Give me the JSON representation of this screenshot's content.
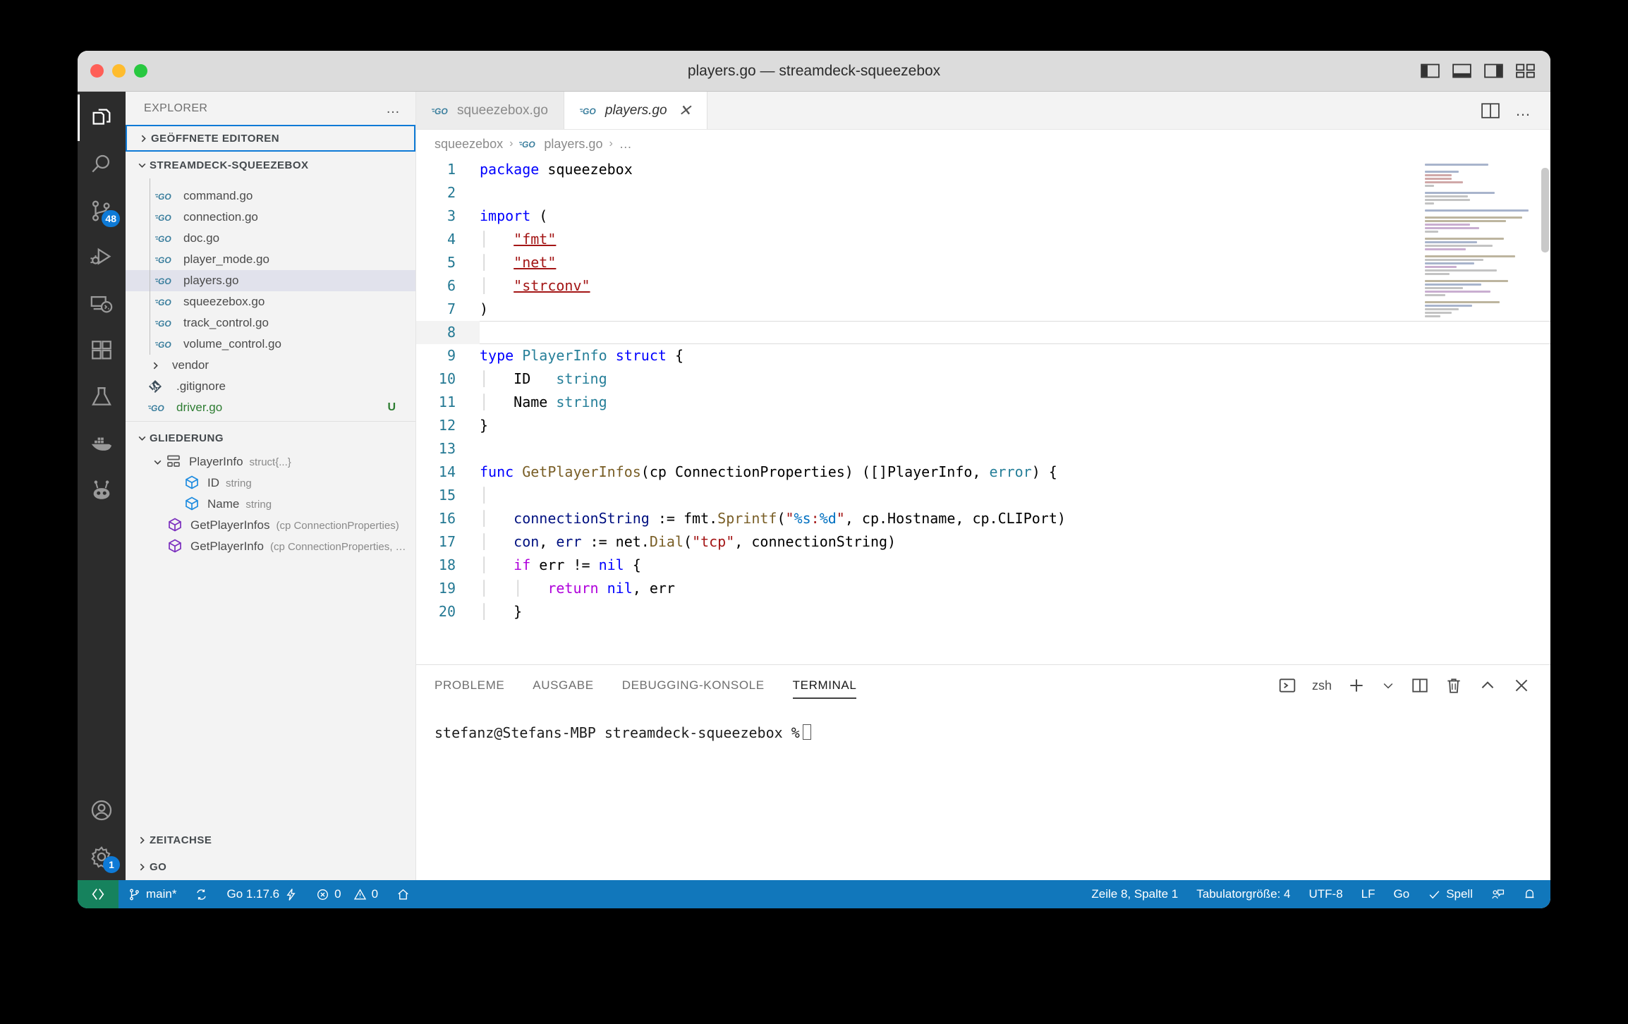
{
  "window": {
    "title": "players.go — streamdeck-squeezebox",
    "traffic_lights": [
      "close",
      "minimize",
      "zoom"
    ]
  },
  "activitybar": {
    "items": [
      {
        "name": "explorer",
        "icon": "files-icon",
        "active": true,
        "badge": null
      },
      {
        "name": "search",
        "icon": "search-icon",
        "active": false,
        "badge": null
      },
      {
        "name": "source-control",
        "icon": "source-control-icon",
        "active": false,
        "badge": "48"
      },
      {
        "name": "run-debug",
        "icon": "run-debug-icon",
        "active": false,
        "badge": null
      },
      {
        "name": "remote-explorer",
        "icon": "remote-explorer-icon",
        "active": false,
        "badge": null
      },
      {
        "name": "extensions",
        "icon": "extensions-icon",
        "active": false,
        "badge": null
      },
      {
        "name": "testing",
        "icon": "beaker-icon",
        "active": false,
        "badge": null
      },
      {
        "name": "docker",
        "icon": "docker-icon",
        "active": false,
        "badge": null
      },
      {
        "name": "bot",
        "icon": "bot-icon",
        "active": false,
        "badge": null
      }
    ],
    "bottom_items": [
      {
        "name": "accounts",
        "icon": "account-icon",
        "badge": null
      },
      {
        "name": "manage",
        "icon": "gear-icon",
        "badge": "1"
      }
    ]
  },
  "sidebar": {
    "header": "EXPLORER",
    "more_actions": "…",
    "sections": [
      {
        "id": "open-editors",
        "label": "GEÖFFNETE EDITOREN",
        "expanded": false,
        "focused": true
      },
      {
        "id": "workspace",
        "label": "STREAMDECK-SQUEEZEBOX",
        "expanded": true,
        "focused": false
      }
    ],
    "files": [
      {
        "name": "command.go",
        "icon": "go-file-icon",
        "selected": false,
        "git": ""
      },
      {
        "name": "connection.go",
        "icon": "go-file-icon",
        "selected": false,
        "git": ""
      },
      {
        "name": "doc.go",
        "icon": "go-file-icon",
        "selected": false,
        "git": ""
      },
      {
        "name": "player_mode.go",
        "icon": "go-file-icon",
        "selected": false,
        "git": ""
      },
      {
        "name": "players.go",
        "icon": "go-file-icon",
        "selected": true,
        "git": ""
      },
      {
        "name": "squeezebox.go",
        "icon": "go-file-icon",
        "selected": false,
        "git": ""
      },
      {
        "name": "track_control.go",
        "icon": "go-file-icon",
        "selected": false,
        "git": ""
      },
      {
        "name": "volume_control.go",
        "icon": "go-file-icon",
        "selected": false,
        "git": ""
      }
    ],
    "folders": [
      {
        "name": "vendor",
        "icon": "chevron-right-icon",
        "expanded": false
      }
    ],
    "root_files": [
      {
        "name": ".gitignore",
        "icon": "git-icon",
        "git": "",
        "untracked": false
      },
      {
        "name": "driver.go",
        "icon": "go-file-icon",
        "git": "U",
        "untracked": true
      }
    ],
    "outline": {
      "label": "GLIEDERUNG",
      "expanded": true,
      "items": [
        {
          "name": "PlayerInfo",
          "detail": "struct{...}",
          "symbol": "struct-icon",
          "depth": 1,
          "expandable": true
        },
        {
          "name": "ID",
          "detail": "string",
          "symbol": "field-icon",
          "depth": 2,
          "expandable": false
        },
        {
          "name": "Name",
          "detail": "string",
          "symbol": "field-icon",
          "depth": 2,
          "expandable": false
        },
        {
          "name": "GetPlayerInfos",
          "detail": "(cp ConnectionProperties)",
          "symbol": "function-icon",
          "depth": 1,
          "expandable": false
        },
        {
          "name": "GetPlayerInfo",
          "detail": "(cp ConnectionProperties, …",
          "symbol": "function-icon",
          "depth": 1,
          "expandable": false
        }
      ]
    },
    "bottom_sections": [
      {
        "id": "timeline",
        "label": "ZEITACHSE",
        "expanded": false
      },
      {
        "id": "go",
        "label": "GO",
        "expanded": false
      }
    ]
  },
  "editor": {
    "tabs": [
      {
        "label": "squeezebox.go",
        "icon": "go-file-icon",
        "active": false,
        "closable": false
      },
      {
        "label": "players.go",
        "icon": "go-file-icon",
        "active": true,
        "closable": true,
        "close_label": "✕"
      }
    ],
    "actions": [
      {
        "name": "split-editor",
        "icon": "split-editor-icon"
      },
      {
        "name": "more-actions",
        "icon": "more-actions-icon",
        "label": "…"
      }
    ],
    "breadcrumbs": [
      {
        "label": "squeezebox",
        "icon": null
      },
      {
        "label": "players.go",
        "icon": "go-file-icon"
      },
      {
        "label": "…",
        "icon": null
      }
    ],
    "first_line_number": 1,
    "lines": [
      {
        "n": 1,
        "tokens": [
          {
            "t": "package ",
            "c": "kw"
          },
          {
            "t": "squeezebox",
            "c": "plain"
          }
        ]
      },
      {
        "n": 2,
        "tokens": []
      },
      {
        "n": 3,
        "tokens": [
          {
            "t": "import",
            "c": "kw"
          },
          {
            "t": " (",
            "c": "plain"
          }
        ]
      },
      {
        "n": 4,
        "tokens": [
          {
            "t": "    ",
            "c": "ig"
          },
          {
            "t": "\"fmt\"",
            "c": "str-err"
          }
        ]
      },
      {
        "n": 5,
        "tokens": [
          {
            "t": "    ",
            "c": "ig"
          },
          {
            "t": "\"net\"",
            "c": "str-err"
          }
        ]
      },
      {
        "n": 6,
        "tokens": [
          {
            "t": "    ",
            "c": "ig"
          },
          {
            "t": "\"strconv\"",
            "c": "str-err"
          }
        ]
      },
      {
        "n": 7,
        "tokens": [
          {
            "t": ")",
            "c": "plain"
          }
        ]
      },
      {
        "n": 8,
        "tokens": [],
        "current": true
      },
      {
        "n": 9,
        "tokens": [
          {
            "t": "type ",
            "c": "kw"
          },
          {
            "t": "PlayerInfo",
            "c": "type"
          },
          {
            "t": " ",
            "c": "plain"
          },
          {
            "t": "struct",
            "c": "kw"
          },
          {
            "t": " {",
            "c": "plain"
          }
        ]
      },
      {
        "n": 10,
        "tokens": [
          {
            "t": "    ",
            "c": "ig"
          },
          {
            "t": "ID   ",
            "c": "plain"
          },
          {
            "t": "string",
            "c": "type"
          }
        ]
      },
      {
        "n": 11,
        "tokens": [
          {
            "t": "    ",
            "c": "ig"
          },
          {
            "t": "Name ",
            "c": "plain"
          },
          {
            "t": "string",
            "c": "type"
          }
        ]
      },
      {
        "n": 12,
        "tokens": [
          {
            "t": "}",
            "c": "plain"
          }
        ]
      },
      {
        "n": 13,
        "tokens": []
      },
      {
        "n": 14,
        "tokens": [
          {
            "t": "func ",
            "c": "kw"
          },
          {
            "t": "GetPlayerInfos",
            "c": "fn"
          },
          {
            "t": "(cp ConnectionProperties) ([]PlayerInfo, ",
            "c": "plain"
          },
          {
            "t": "error",
            "c": "type"
          },
          {
            "t": ") {",
            "c": "plain"
          }
        ]
      },
      {
        "n": 15,
        "tokens": []
      },
      {
        "n": 16,
        "tokens": [
          {
            "t": "    ",
            "c": "ig"
          },
          {
            "t": "connectionString",
            "c": "var"
          },
          {
            "t": " := fmt.",
            "c": "plain"
          },
          {
            "t": "Sprintf",
            "c": "fn"
          },
          {
            "t": "(",
            "c": "plain"
          },
          {
            "t": "\"%s:%d\"",
            "c": "strfmt"
          },
          {
            "t": ", cp.Hostname, cp.CLIPort)",
            "c": "plain"
          }
        ]
      },
      {
        "n": 17,
        "tokens": [
          {
            "t": "    ",
            "c": "ig"
          },
          {
            "t": "con",
            "c": "var"
          },
          {
            "t": ", ",
            "c": "plain"
          },
          {
            "t": "err",
            "c": "var"
          },
          {
            "t": " := net.",
            "c": "plain"
          },
          {
            "t": "Dial",
            "c": "fn"
          },
          {
            "t": "(",
            "c": "plain"
          },
          {
            "t": "\"tcp\"",
            "c": "str"
          },
          {
            "t": ", connectionString)",
            "c": "plain"
          }
        ]
      },
      {
        "n": 18,
        "tokens": [
          {
            "t": "    ",
            "c": "ig"
          },
          {
            "t": "if",
            "c": "kw2"
          },
          {
            "t": " err != ",
            "c": "plain"
          },
          {
            "t": "nil",
            "c": "kw"
          },
          {
            "t": " {",
            "c": "plain"
          }
        ]
      },
      {
        "n": 19,
        "tokens": [
          {
            "t": "        ",
            "c": "ig"
          },
          {
            "t": "return ",
            "c": "kw2"
          },
          {
            "t": "nil",
            "c": "kw"
          },
          {
            "t": ", err",
            "c": "plain"
          }
        ]
      },
      {
        "n": 20,
        "tokens": [
          {
            "t": "    ",
            "c": "ig"
          },
          {
            "t": "}",
            "c": "plain"
          }
        ]
      }
    ]
  },
  "panel": {
    "tabs": [
      {
        "label": "PROBLEME",
        "active": false
      },
      {
        "label": "AUSGABE",
        "active": false
      },
      {
        "label": "DEBUGGING-KONSOLE",
        "active": false
      },
      {
        "label": "TERMINAL",
        "active": true
      }
    ],
    "shell": "zsh",
    "actions": [
      {
        "name": "launch-profile",
        "icon": "terminal-icon"
      },
      {
        "name": "new-terminal",
        "icon": "plus-icon"
      },
      {
        "name": "profile-dropdown",
        "icon": "chevron-down-icon"
      },
      {
        "name": "split-terminal",
        "icon": "split-icon"
      },
      {
        "name": "kill-terminal",
        "icon": "trash-icon"
      },
      {
        "name": "maximize-panel",
        "icon": "chevron-up-icon"
      },
      {
        "name": "close-panel",
        "icon": "close-icon"
      }
    ],
    "terminal_prompt": "stefanz@Stefans-MBP streamdeck-squeezebox %"
  },
  "statusbar": {
    "remote_icon": "remote-indicator-icon",
    "left": [
      {
        "name": "branch",
        "icon": "git-branch-icon",
        "label": "main*"
      },
      {
        "name": "sync",
        "icon": "sync-icon",
        "label": ""
      },
      {
        "name": "go-version",
        "icon": "zap-icon",
        "label": "Go 1.17.6"
      },
      {
        "name": "errors",
        "icon": "error-icon",
        "label": "0"
      },
      {
        "name": "warnings",
        "icon": "warning-icon",
        "label": "0"
      },
      {
        "name": "home",
        "icon": "home-icon",
        "label": ""
      }
    ],
    "right": [
      {
        "name": "cursor-position",
        "icon": null,
        "label": "Zeile 8, Spalte 1"
      },
      {
        "name": "indentation",
        "icon": null,
        "label": "Tabulatorgröße: 4"
      },
      {
        "name": "encoding",
        "icon": null,
        "label": "UTF-8"
      },
      {
        "name": "eol",
        "icon": null,
        "label": "LF"
      },
      {
        "name": "language-mode",
        "icon": null,
        "label": "Go"
      },
      {
        "name": "spell-checker",
        "icon": "check-icon",
        "label": "Spell"
      },
      {
        "name": "feedback",
        "icon": "feedback-icon",
        "label": ""
      },
      {
        "name": "notifications",
        "icon": "bell-icon",
        "label": ""
      }
    ]
  },
  "colors": {
    "accent": "#0e7ad6",
    "statusbar": "#1177bb",
    "remote": "#16825d",
    "activitybar": "#2c2c2c",
    "sidebar": "#f3f3f3",
    "selection": "#e1e2ec",
    "untracked": "#2e7d32"
  }
}
